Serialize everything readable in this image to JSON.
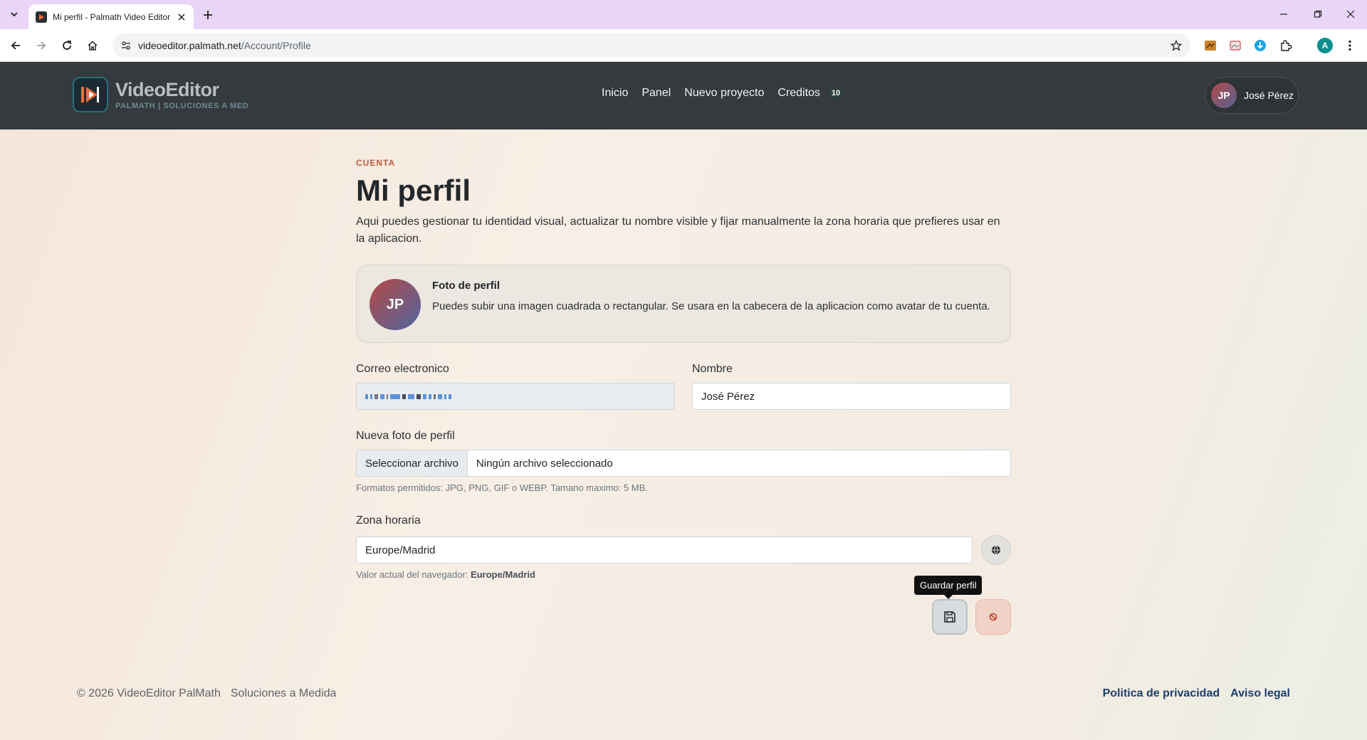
{
  "browser": {
    "tab_title": "Mi perfil - Palmath Video Editor",
    "url_host": "videoeditor.palmath.net",
    "url_path": "/Account/Profile",
    "profile_initial": "A"
  },
  "header": {
    "logo_name": "VideoEditor",
    "logo_tagline": "PALMATH | SOLUCIONES A MED",
    "nav": {
      "inicio": "Inicio",
      "panel": "Panel",
      "nuevo_proyecto": "Nuevo proyecto",
      "creditos": "Creditos",
      "creditos_count": "10"
    },
    "user": {
      "initials": "JP",
      "name": "José Pérez"
    }
  },
  "main": {
    "eyebrow": "CUENTA",
    "title": "Mi perfil",
    "lead": "Aqui puedes gestionar tu identidad visual, actualizar tu nombre visible y fijar manualmente la zona horaria que prefieres usar en la aplicacion.",
    "photo_card": {
      "initials": "JP",
      "title": "Foto de perfil",
      "text": "Puedes subir una imagen cuadrada o rectangular. Se usara en la cabecera de la aplicacion como avatar de tu cuenta."
    },
    "form": {
      "email_label": "Correo electronico",
      "name_label": "Nombre",
      "name_value": "José Pérez",
      "photo_label": "Nueva foto de perfil",
      "file_button": "Seleccionar archivo",
      "file_status": "Ningún archivo seleccionado",
      "photo_help": "Formatos permitidos: JPG, PNG, GIF o WEBP. Tamano maximo: 5 MB.",
      "tz_label": "Zona horaria",
      "tz_value": "Europe/Madrid",
      "tz_help_prefix": "Valor actual del navegador:",
      "tz_help_value": "Europe/Madrid",
      "save_tooltip": "Guardar perfil"
    }
  },
  "footer": {
    "copyright": "© 2026 VideoEditor PalMath",
    "tagline": "Soluciones a Medida",
    "privacy": "Politica de privacidad",
    "legal": "Aviso legal"
  },
  "colors": {
    "header_bg": "#353a3e",
    "eyebrow": "#c05a3c",
    "link": "#1d3f6e",
    "tab_strip": "#e9d5f7"
  }
}
